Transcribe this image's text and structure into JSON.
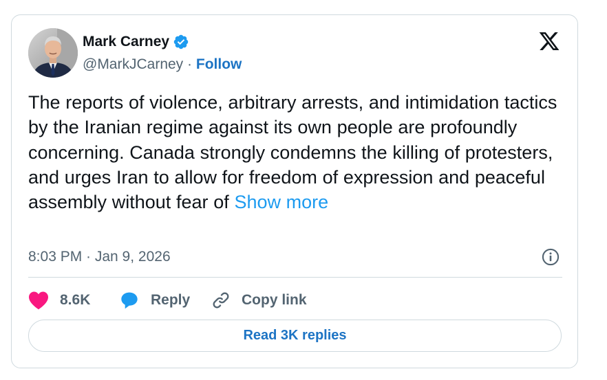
{
  "author": {
    "name": "Mark Carney",
    "handle": "@MarkJCarney",
    "separator": "·",
    "follow_label": "Follow",
    "verified_icon": "verified-badge-icon"
  },
  "platform_icon": "x-logo-icon",
  "tweet": {
    "text": "The reports of violence, arbitrary arrests, and intimidation tactics by the Iranian regime against its own people are profoundly concerning. Canada strongly condemns the killing of protesters, and urges Iran to allow for freedom of expression and peaceful assembly without fear of",
    "show_more_label": "Show more",
    "timestamp": "8:03 PM · Jan 9, 2026"
  },
  "actions": {
    "like_count": "8.6K",
    "reply_label": "Reply",
    "copy_link_label": "Copy link"
  },
  "read_replies_label": "Read 3K replies",
  "colors": {
    "accent_blue": "#1d9bf0",
    "link_blue": "#1d74c4",
    "like_pink": "#f91880",
    "text_primary": "#0f1419",
    "text_secondary": "#536471",
    "border": "#cfd9de"
  }
}
